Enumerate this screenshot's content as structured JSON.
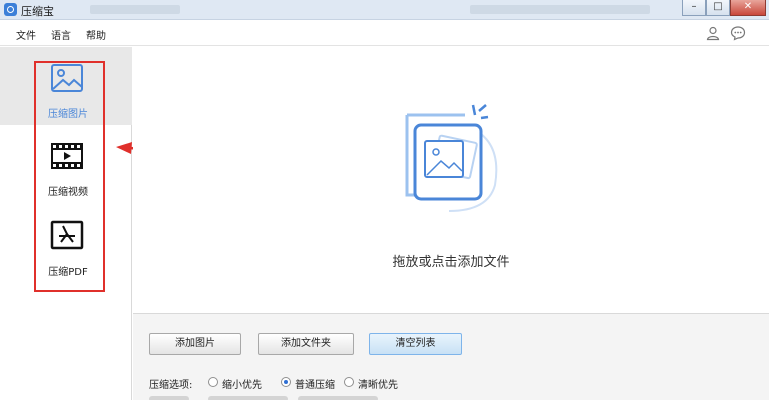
{
  "window": {
    "title": "压缩宝"
  },
  "menu": {
    "items": [
      "文件",
      "语言",
      "帮助"
    ]
  },
  "sidebar": {
    "items": [
      {
        "label": "压缩图片",
        "icon": "image-icon",
        "active": true
      },
      {
        "label": "压缩视频",
        "icon": "video-icon",
        "active": false
      },
      {
        "label": "压缩PDF",
        "icon": "pdf-icon",
        "active": false
      }
    ]
  },
  "main": {
    "drop_text": "拖放或点击添加文件",
    "buttons": {
      "add_image": "添加图片",
      "add_folder": "添加文件夹",
      "clear_list": "清空列表"
    },
    "options": {
      "label": "压缩选项:",
      "choices": [
        "缩小优先",
        "普通压缩",
        "清晰优先"
      ],
      "selected": "普通压缩"
    }
  },
  "colors": {
    "accent": "#4a86d8",
    "annotation": "#e0302b",
    "active_bg": "#e8e8e8"
  }
}
